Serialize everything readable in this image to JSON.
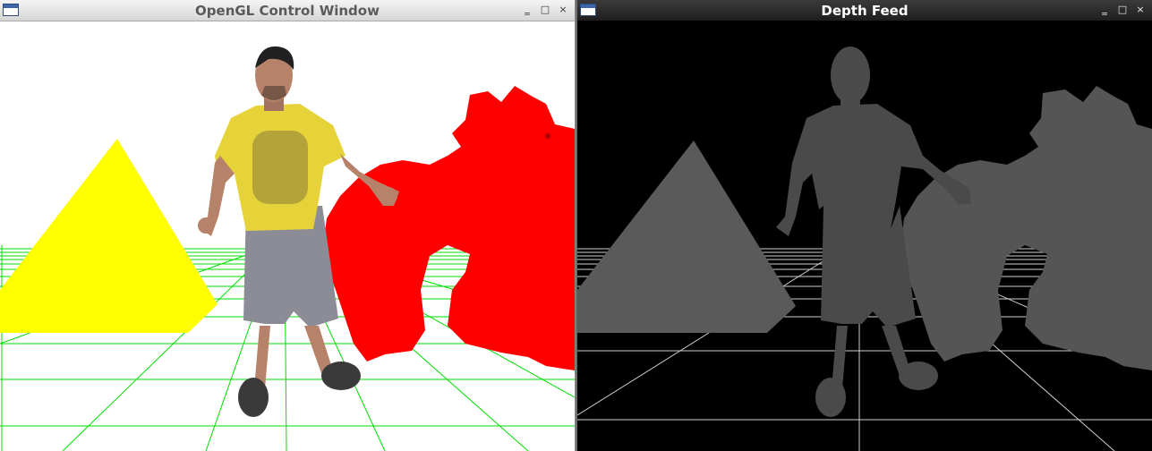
{
  "windows": {
    "control": {
      "title": "OpenGL Control Window",
      "icon": "window-icon",
      "controls": {
        "minimize": "‗",
        "maximize": "□",
        "close": "×"
      }
    },
    "depth": {
      "title": "Depth Feed",
      "icon": "window-icon",
      "controls": {
        "minimize": "‗",
        "maximize": "□",
        "close": "×"
      }
    }
  },
  "scene": {
    "colors": {
      "grid_control": "#00dd00",
      "pyramid_control": "#ffff00",
      "dragon_control": "#ff0000",
      "shirt": "#e6d33a",
      "shorts": "#8c8c96",
      "skin": "#b7826a",
      "grid_depth": "#cfcfcf",
      "pyramid_depth": "#5a5a5a",
      "person_depth": "#4a4a4a",
      "dragon_depth": "#555555"
    }
  }
}
